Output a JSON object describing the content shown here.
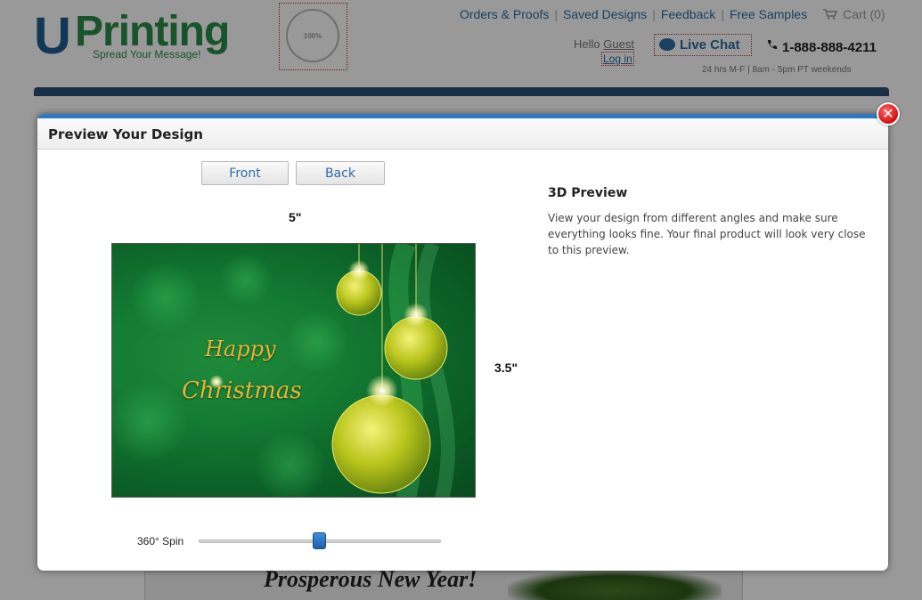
{
  "site": {
    "logo_u": "U",
    "logo_printing": "Printing",
    "logo_tagline": "Spread Your Message!",
    "guarantee_icon": "quality-guarantee-seal",
    "top_links": [
      "Orders & Proofs",
      "Saved Designs",
      "Feedback",
      "Free Samples"
    ],
    "cart_label": "Cart (0)",
    "hello_prefix": "Hello",
    "hello_user": "Guest",
    "login_label": "Log in",
    "live_chat_label": "Live Chat",
    "phone": "1-888-888-4211",
    "hours": "24 hrs M-F | 8am - 5pm PT weekends",
    "bottom_text": "Prosperous New Year!"
  },
  "modal": {
    "title": "Preview Your Design",
    "front_label": "Front",
    "back_label": "Back",
    "width_label": "5\"",
    "height_label": "3.5\"",
    "card_line1": "Happy",
    "card_line2": "Christmas",
    "spin_label": "360° Spin",
    "spin_value_fraction": 0.5,
    "preview_title": "3D Preview",
    "preview_desc": "View your design from different angles and make sure everything looks fine. Your final product will look very close to this preview.",
    "close_icon": "close-icon"
  },
  "colors": {
    "link_blue": "#2d6ca3",
    "brand_green": "#2a8a4a",
    "nav_bar": "#2b4f74",
    "card_gold": "#e0b640"
  }
}
